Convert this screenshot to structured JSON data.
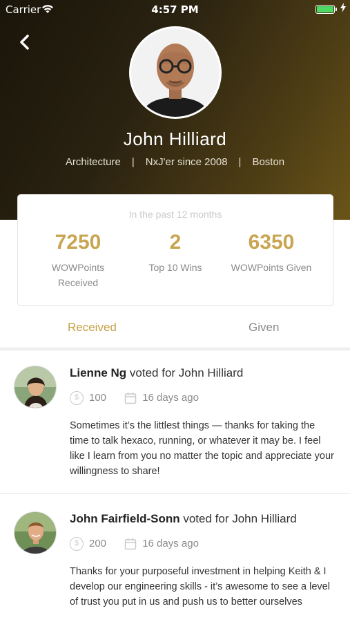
{
  "status_bar": {
    "carrier": "Carrier",
    "time": "4:57 PM",
    "battery_level": 1.0
  },
  "profile": {
    "name": "John Hilliard",
    "department": "Architecture",
    "separator": "|",
    "tenure": "NxJ'er since 2008",
    "location": "Boston"
  },
  "stats": {
    "caption": "In the past 12 months",
    "items": [
      {
        "value": "7250",
        "label_line1": "WOWPoints",
        "label_line2": "Received"
      },
      {
        "value": "2",
        "label_line1": "Top 10 Wins",
        "label_line2": ""
      },
      {
        "value": "6350",
        "label_line1": "WOWPoints Given",
        "label_line2": ""
      }
    ]
  },
  "tabs": {
    "received": "Received",
    "given": "Given",
    "active": "received"
  },
  "feed": [
    {
      "voter": "Lienne Ng",
      "action": "voted for John Hilliard",
      "points": "100",
      "coin_symbol": "$",
      "when": "16 days ago",
      "message": "Sometimes it’s the littlest things — thanks for taking the time to talk hexaco, running, or whatever it may be. I feel like I learn from you no matter the topic and appreciate your willingness to share!"
    },
    {
      "voter": "John Fairfield-Sonn",
      "action": "voted for John Hilliard",
      "points": "200",
      "coin_symbol": "$",
      "when": "16 days ago",
      "message": "Thanks for your purposeful investment in helping Keith & I develop our engineering skills - it’s awesome to see a level of trust you put in us and push us to better ourselves"
    }
  ],
  "colors": {
    "accent": "#c9a552",
    "tab_active": "#c2a045",
    "muted": "#8a8a8a",
    "battery": "#4cd964"
  },
  "icons": {
    "back": "chevron-left-icon",
    "wifi": "wifi-icon",
    "coin": "coin-icon",
    "calendar": "calendar-icon"
  }
}
